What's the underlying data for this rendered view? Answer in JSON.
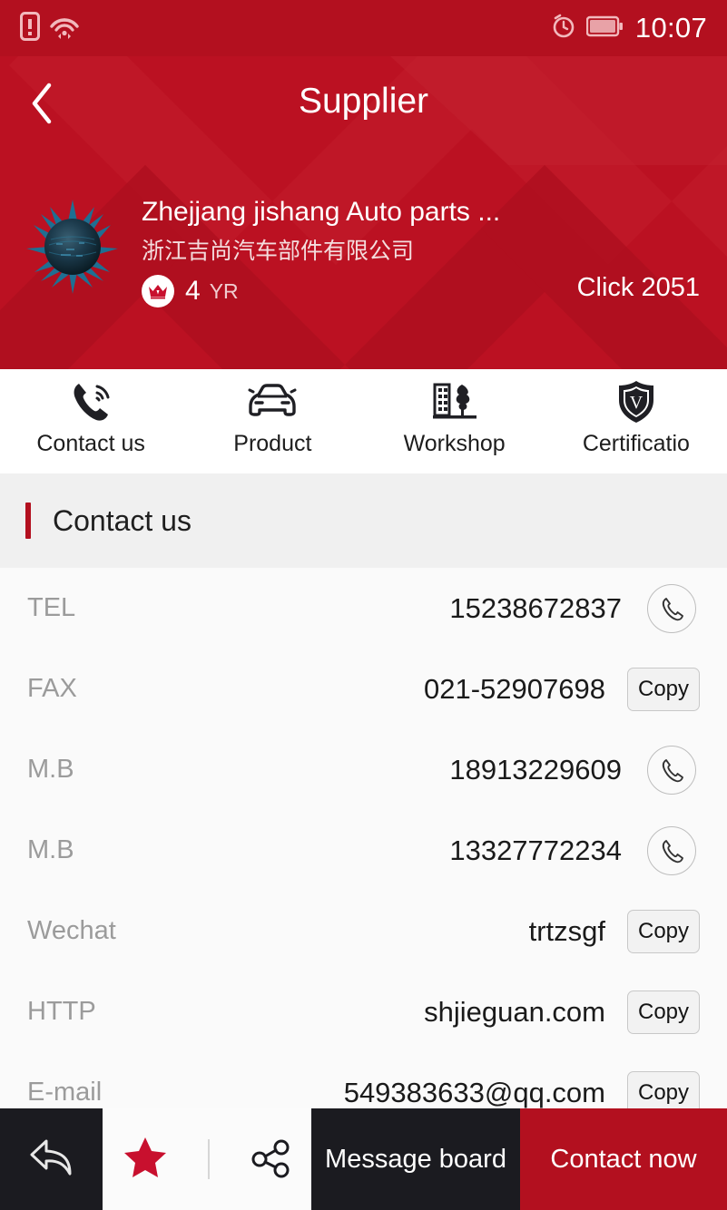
{
  "statusbar": {
    "time": "10:07",
    "icons": [
      "sim-card-alert-icon",
      "wifi-icon",
      "alarm-clock-icon",
      "battery-icon"
    ]
  },
  "header": {
    "title": "Supplier",
    "back_icon": "chevron-left-icon",
    "background_color": "#bb1122"
  },
  "company": {
    "name_en": "Zhejjang jishang Auto parts ...",
    "name_cn": "浙江吉尚汽车部件有限公司",
    "years_value": "4",
    "years_unit": "YR",
    "badge_icon": "crown-icon",
    "click_label": "Click 2051",
    "avatar_icon": "spiky-sphere-avatar"
  },
  "tabs": [
    {
      "label": "Contact us",
      "icon": "phone-ring-icon"
    },
    {
      "label": "Product",
      "icon": "car-icon"
    },
    {
      "label": "Workshop",
      "icon": "factory-tree-icon"
    },
    {
      "label": "Certificatio",
      "icon": "shield-v-icon"
    }
  ],
  "section": {
    "title": "Contact us",
    "accent_color": "#b3101f"
  },
  "contacts": [
    {
      "label": "TEL",
      "value": "15238672837",
      "action": "call",
      "action_label": "",
      "action_icon": "phone-icon"
    },
    {
      "label": "FAX",
      "value": "021-52907698",
      "action": "copy",
      "action_label": "Copy",
      "action_icon": ""
    },
    {
      "label": "M.B",
      "value": "18913229609",
      "action": "call",
      "action_label": "",
      "action_icon": "phone-icon"
    },
    {
      "label": "M.B",
      "value": "13327772234",
      "action": "call",
      "action_label": "",
      "action_icon": "phone-icon"
    },
    {
      "label": "Wechat",
      "value": "trtzsgf",
      "action": "copy",
      "action_label": "Copy",
      "action_icon": ""
    },
    {
      "label": "HTTP",
      "value": "shjieguan.com",
      "action": "copy",
      "action_label": "Copy",
      "action_icon": ""
    },
    {
      "label": "E-mail",
      "value": "549383633@qq.com",
      "action": "copy",
      "action_label": "Copy",
      "action_icon": ""
    }
  ],
  "bottombar": {
    "back_icon": "reply-arrow-icon",
    "favorite_icon": "star-icon",
    "favorite_color": "#c8102e",
    "share_icon": "share-nodes-icon",
    "message_label": "Message board",
    "contact_label": "Contact now",
    "contact_color": "#b3101f",
    "dark_color": "#1b1b20"
  }
}
